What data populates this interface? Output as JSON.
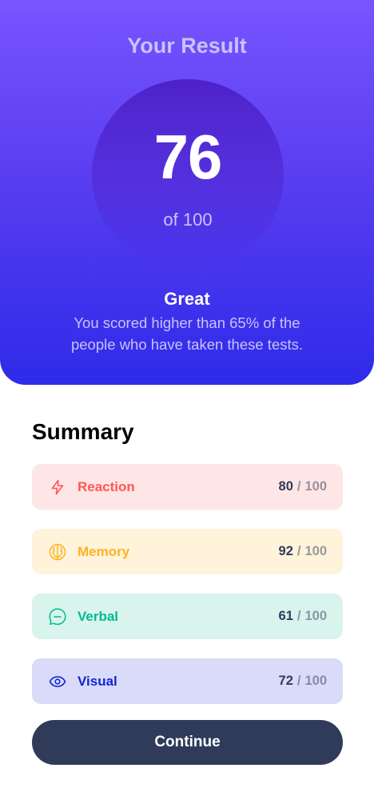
{
  "result": {
    "title": "Your Result",
    "score": "76",
    "max_label": "of 100",
    "rating": "Great",
    "description": "You scored higher than 65% of the people who have taken these tests."
  },
  "summary": {
    "title": "Summary",
    "items": [
      {
        "label": "Reaction",
        "score": "80",
        "separator": "/",
        "max": "100",
        "icon": "lightning-icon",
        "color": "#ff5757"
      },
      {
        "label": "Memory",
        "score": "92",
        "separator": "/",
        "max": "100",
        "icon": "brain-icon",
        "color": "#ffb21e"
      },
      {
        "label": "Verbal",
        "score": "61",
        "separator": "/",
        "max": "100",
        "icon": "chat-bubble-icon",
        "color": "#00bb8f"
      },
      {
        "label": "Visual",
        "score": "72",
        "separator": "/",
        "max": "100",
        "icon": "eye-icon",
        "color": "#1125d6"
      }
    ]
  },
  "actions": {
    "continue_label": "Continue"
  },
  "colors": {
    "gradient_top": "#7755ff",
    "gradient_bottom": "#2e2be9",
    "button": "#303b5a"
  }
}
